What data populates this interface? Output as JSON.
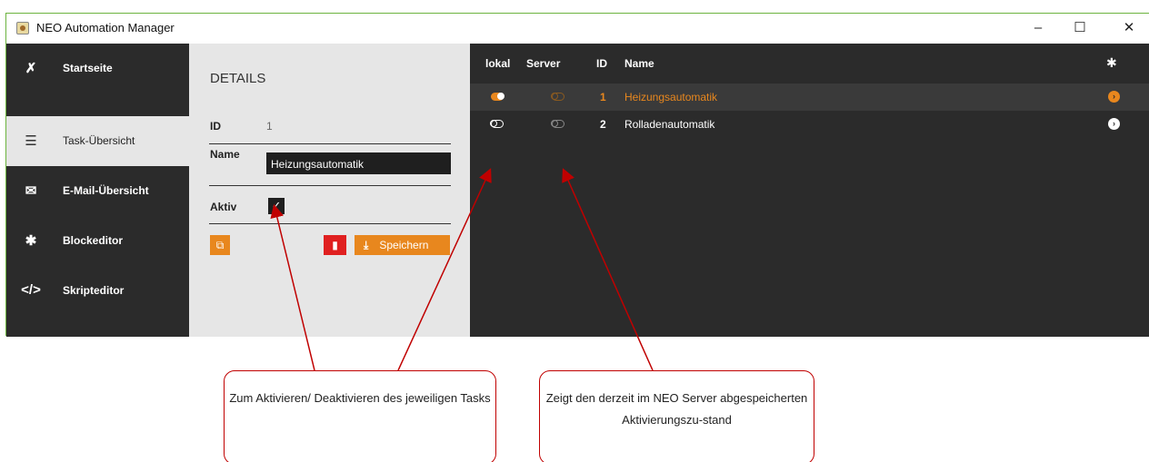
{
  "window": {
    "title": "NEO Automation Manager",
    "controls": {
      "minimize": "–",
      "maximize": "☐",
      "close": "✕"
    }
  },
  "sidebar": {
    "items": [
      {
        "label": "Startseite",
        "icon": "home-icon",
        "glyph": "✗"
      },
      {
        "label": "Task-Übersicht",
        "icon": "list-icon",
        "glyph": "☰"
      },
      {
        "label": "E-Mail-Übersicht",
        "icon": "mail-icon",
        "glyph": "✉"
      },
      {
        "label": "Blockeditor",
        "icon": "puzzle-icon",
        "glyph": "✱"
      },
      {
        "label": "Skripteditor",
        "icon": "code-icon",
        "glyph": "</>"
      }
    ],
    "active_index": 1
  },
  "details": {
    "title": "DETAILS",
    "id_label": "ID",
    "id_value": "1",
    "name_label": "Name",
    "name_value": "Heizungsautomatik",
    "active_label": "Aktiv",
    "active_checked": true,
    "save_label": "Speichern"
  },
  "tasks": {
    "headers": {
      "local": "lokal",
      "server": "Server",
      "id": "ID",
      "name": "Name"
    },
    "rows": [
      {
        "local_on": true,
        "server_on": false,
        "id": "1",
        "name": "Heizungsautomatik",
        "selected": true
      },
      {
        "local_on": false,
        "server_on": false,
        "id": "2",
        "name": "Rolladenautomatik",
        "selected": false
      }
    ]
  },
  "annotations": {
    "callout_1": "Zum Aktivieren/ Deaktivieren des jeweiligen Tasks",
    "callout_2": "Zeigt den derzeit im NEO Server abgespeicherten Aktivierungszu-stand"
  },
  "colors": {
    "accent": "#e8871e",
    "danger": "#e02020",
    "dark": "#2b2b2b",
    "panel": "#e6e6e6",
    "arrow": "#c00000"
  }
}
